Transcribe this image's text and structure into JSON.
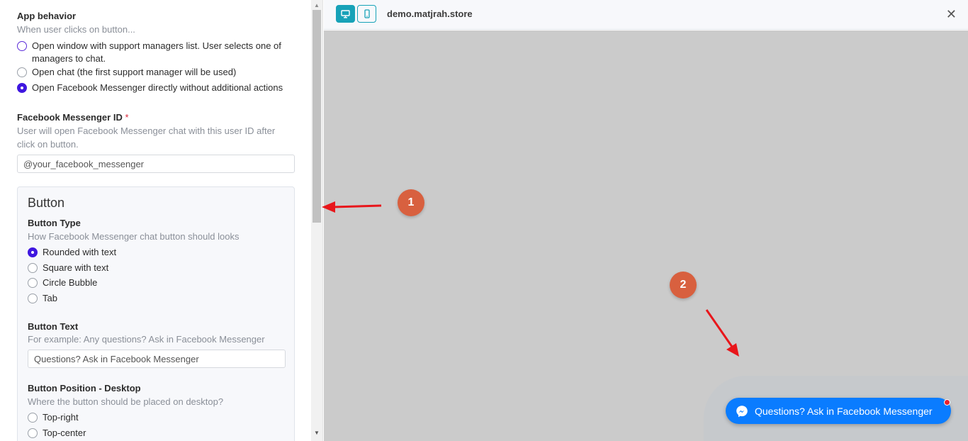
{
  "app_behavior": {
    "label": "App behavior",
    "help": "When user clicks on button...",
    "options": [
      {
        "text": "Open window with support managers list. User selects one of managers to chat."
      },
      {
        "text": "Open chat (the first support manager will be used)"
      },
      {
        "text": "Open Facebook Messenger directly without additional actions"
      }
    ],
    "selected": "Open Facebook Messenger directly without additional actions"
  },
  "messenger_id": {
    "label": "Facebook Messenger ID",
    "required_mark": "*",
    "help": "User will open Facebook Messenger chat with this user ID after click on button.",
    "value": "@your_facebook_messenger"
  },
  "button_section": {
    "title": "Button",
    "type": {
      "label": "Button Type",
      "help": "How Facebook Messenger chat button should looks",
      "options": [
        "Rounded with text",
        "Square with text",
        "Circle Bubble",
        "Tab"
      ],
      "selected": "Rounded with text"
    },
    "text": {
      "label": "Button Text",
      "help": "For example: Any questions? Ask in Facebook Messenger",
      "value": "Questions? Ask in Facebook Messenger"
    },
    "position_desktop": {
      "label": "Button Position - Desktop",
      "help": "Where the button should be placed on desktop?",
      "options": [
        "Top-right",
        "Top-center"
      ]
    }
  },
  "preview": {
    "domain": "demo.matjrah.store",
    "close_glyph": "✕",
    "fb_button_text": "Questions? Ask in Facebook Messenger"
  },
  "annotations": {
    "badge1": "1",
    "badge2": "2",
    "arrow_color": "#e8161b",
    "badge_color": "#d8603f"
  },
  "icons": {
    "desktop": "desktop-icon",
    "mobile": "mobile-icon",
    "messenger": "messenger-icon"
  },
  "colors": {
    "accent": "#3f17e0",
    "toolbar_teal": "#17a2b8",
    "messenger_blue": "#0a7cff"
  }
}
